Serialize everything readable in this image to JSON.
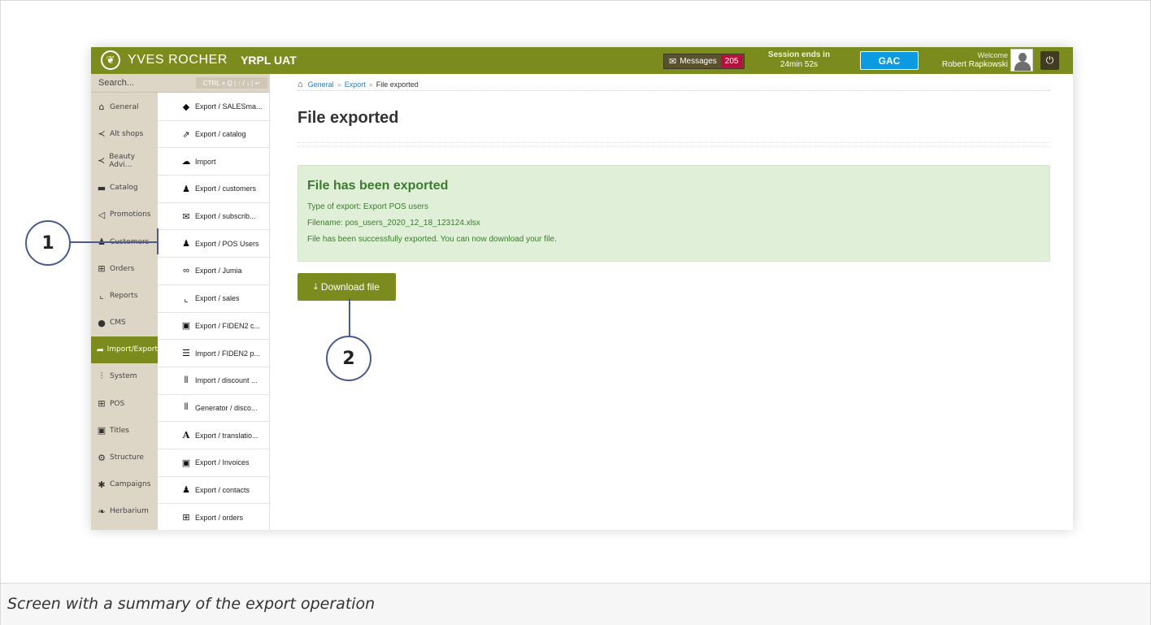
{
  "topbar": {
    "brand_name": "YVES ROCHER",
    "environment": "YRPL UAT",
    "messages_label": "Messages",
    "messages_count": "205",
    "session_title": "Session ends in",
    "session_time": "24min 52s",
    "gac_label": "GAC",
    "welcome_label": "Welcome",
    "user_name": "Robert Rapkowski"
  },
  "search": {
    "placeholder": "Search...",
    "shortcut_hint": "CTRL + Q | ↑ / ↓ | ↵"
  },
  "leftnav": {
    "items": [
      {
        "label": "General",
        "icon": "home-icon"
      },
      {
        "label": "Alt shops",
        "icon": "share-icon"
      },
      {
        "label": "Beauty Advi...",
        "icon": "share-icon"
      },
      {
        "label": "Catalog",
        "icon": "folder-icon"
      },
      {
        "label": "Promotions",
        "icon": "megaphone-icon"
      },
      {
        "label": "Customers",
        "icon": "users-icon"
      },
      {
        "label": "Orders",
        "icon": "cart-icon"
      },
      {
        "label": "Reports",
        "icon": "chart-icon"
      },
      {
        "label": "CMS",
        "icon": "globe-icon"
      },
      {
        "label": "Import/Export",
        "icon": "arrow-icon"
      },
      {
        "label": "System",
        "icon": "sliders-icon"
      },
      {
        "label": "POS",
        "icon": "cart-icon"
      },
      {
        "label": "Titles",
        "icon": "card-icon"
      },
      {
        "label": "Structure",
        "icon": "cogs-icon"
      },
      {
        "label": "Campaigns",
        "icon": "asterisk-icon"
      },
      {
        "label": "Herbarium",
        "icon": "leaf-icon"
      }
    ],
    "active": "Import/Export"
  },
  "subnav": {
    "items": [
      {
        "label": "Export / SALESma...",
        "icon": "tag-icon"
      },
      {
        "label": "Export / catalog",
        "icon": "share-square-icon"
      },
      {
        "label": "Import",
        "icon": "cloud-icon"
      },
      {
        "label": "Export / customers",
        "icon": "users-icon"
      },
      {
        "label": "Export / subscrib...",
        "icon": "envelope-icon"
      },
      {
        "label": "Export / POS Users",
        "icon": "user-icon"
      },
      {
        "label": "Export / Jumia",
        "icon": "link-icon"
      },
      {
        "label": "Export / sales",
        "icon": "chart-icon"
      },
      {
        "label": "Export / FIDEN2 c...",
        "icon": "card-icon"
      },
      {
        "label": "Import / FIDEN2 p...",
        "icon": "list-icon"
      },
      {
        "label": "Import / discount ...",
        "icon": "barcode-icon"
      },
      {
        "label": "Generator / disco...",
        "icon": "barcode-icon"
      },
      {
        "label": "Export / translatio...",
        "icon": "font-icon"
      },
      {
        "label": "Export / Invoices",
        "icon": "card-icon"
      },
      {
        "label": "Export / contacts",
        "icon": "users-icon"
      },
      {
        "label": "Export / orders",
        "icon": "cart-icon"
      }
    ]
  },
  "breadcrumb": {
    "items": [
      "General",
      "Export",
      "File exported"
    ],
    "separator": "»"
  },
  "main": {
    "title": "File exported",
    "alert": {
      "title": "File has been exported",
      "type_line": "Type of export: Export POS users",
      "filename_line": "Filename: pos_users_2020_12_18_123124.xlsx",
      "status_line": "File has been successfully exported. You can now download your file."
    },
    "download_label": "Download file"
  },
  "annotations": {
    "callout_1": "1",
    "callout_2": "2"
  },
  "caption": "Screen with a summary of the export operation",
  "colors": {
    "brand_olive": "#7c8b1d",
    "nav_beige": "#ddd5c5",
    "alert_green_bg": "#e0efd8",
    "alert_green_text": "#3c7a2f",
    "messages_badge": "#b3113c",
    "gac_blue": "#0c9be0",
    "callout_stroke": "#4a5a8c"
  }
}
